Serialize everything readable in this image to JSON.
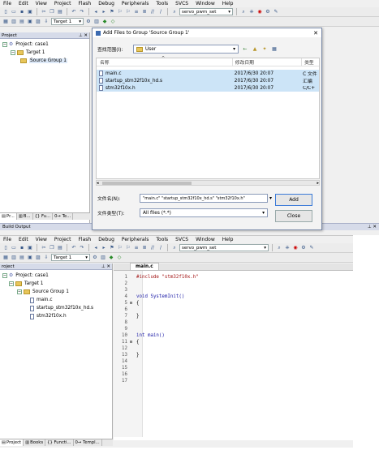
{
  "top_ide": {
    "menu": [
      "File",
      "Edit",
      "View",
      "Project",
      "Flash",
      "Debug",
      "Peripherals",
      "Tools",
      "SVCS",
      "Window",
      "Help"
    ],
    "target_combo": "Target 1",
    "search_combo": "servo_pwm_set",
    "project_panel_title": "Project",
    "tree": {
      "project": "Project: case1",
      "target": "Target 1",
      "group": "Source Group 1"
    },
    "bottom_tabs": [
      "Pr...",
      "B...",
      "{} Fu...",
      "0→ Te..."
    ],
    "build_output_title": "Build Output"
  },
  "dialog": {
    "title": "Add Files to Group 'Source Group 1'",
    "look_in_label": "查找范围(I):",
    "look_in_value": "User",
    "columns": [
      "名称",
      "修改日期",
      "类型"
    ],
    "files": [
      {
        "name": "main.c",
        "date": "2017/6/30 20:07",
        "type": "C 文件"
      },
      {
        "name": "startup_stm32f10x_hd.s",
        "date": "2017/6/30 20:07",
        "type": "汇编"
      },
      {
        "name": "stm32f10x.h",
        "date": "2017/6/30 20:07",
        "type": "C/C+"
      }
    ],
    "filename_label": "文件名(N):",
    "filename_value": "\"main.c\" \"startup_stm32f10x_hd.s\" \"stm32f10x.h\"",
    "filetype_label": "文件类型(T):",
    "filetype_value": "All files (*.*)",
    "add_button": "Add",
    "close_button": "Close"
  },
  "bottom_ide": {
    "menu": [
      "File",
      "Edit",
      "View",
      "Project",
      "Flash",
      "Debug",
      "Peripherals",
      "Tools",
      "SVCS",
      "Window",
      "Help"
    ],
    "target_combo": "Target 1",
    "search_combo": "servo_pwm_set",
    "project_panel_title": "roject",
    "tree": {
      "project": "Project: case1",
      "target": "Target 1",
      "group": "Source Group 1",
      "files": [
        "main.c",
        "startup_stm32f10x_hd.s",
        "stm32f10x.h"
      ]
    },
    "editor_tab": "main.c",
    "code": [
      {
        "n": "1",
        "text": "#include \"stm32f10x.h\"",
        "fold": ""
      },
      {
        "n": "2",
        "text": "",
        "fold": ""
      },
      {
        "n": "3",
        "text": "",
        "fold": ""
      },
      {
        "n": "4",
        "text": "void SystemInit()",
        "fold": ""
      },
      {
        "n": "5",
        "text": "{",
        "fold": "⊟"
      },
      {
        "n": "6",
        "text": "",
        "fold": ""
      },
      {
        "n": "7",
        "text": "}",
        "fold": ""
      },
      {
        "n": "8",
        "text": "",
        "fold": ""
      },
      {
        "n": "9",
        "text": "",
        "fold": ""
      },
      {
        "n": "10",
        "text": "int main()",
        "fold": ""
      },
      {
        "n": "11",
        "text": "{",
        "fold": "⊟"
      },
      {
        "n": "12",
        "text": "",
        "fold": ""
      },
      {
        "n": "13",
        "text": "}",
        "fold": ""
      },
      {
        "n": "14",
        "text": "",
        "fold": ""
      },
      {
        "n": "15",
        "text": "",
        "fold": ""
      },
      {
        "n": "16",
        "text": "",
        "fold": ""
      },
      {
        "n": "17",
        "text": "",
        "fold": ""
      }
    ],
    "bottom_tabs": [
      "Project",
      "Books",
      "{} Functi...",
      "0→ Templ..."
    ]
  },
  "colors": {
    "keyword_blue": "#1a1aa6",
    "string_red": "#a31515",
    "selection": "#cce4f7",
    "title_blue": "#d6dbe9"
  }
}
